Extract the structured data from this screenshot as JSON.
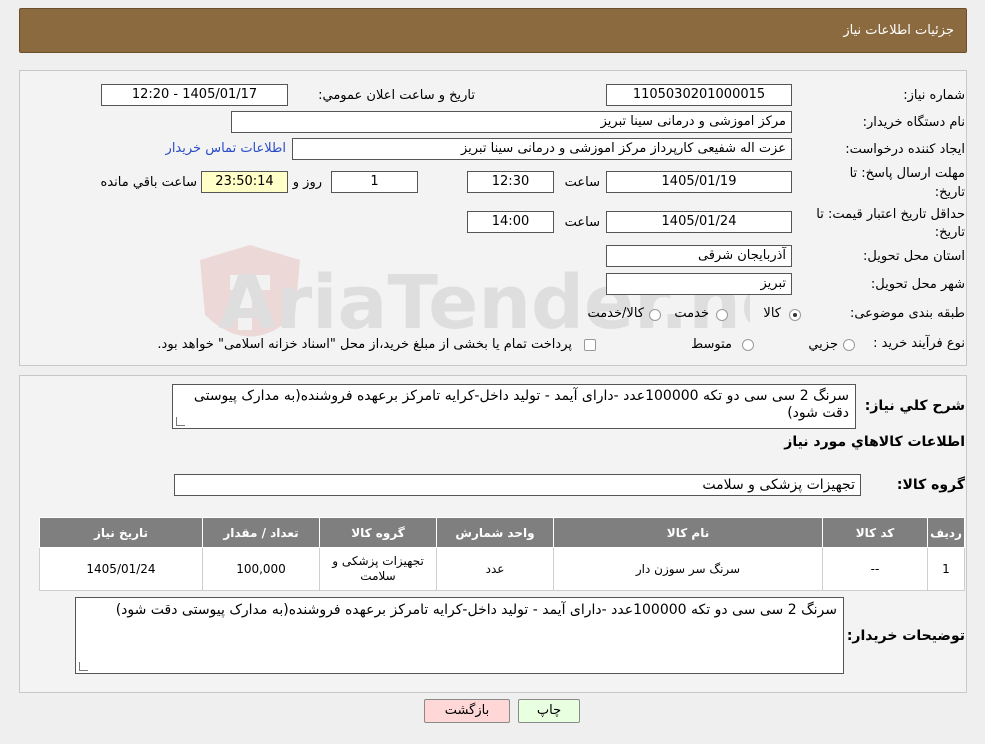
{
  "header": {
    "title": "جزئیات اطلاعات نیاز"
  },
  "watermark": {
    "text": "AriaTender.neT"
  },
  "form": {
    "need_number_label": "شماره نیاز:",
    "need_number": "1105030201000015",
    "announce_label": "تاریخ و ساعت اعلان عمومي:",
    "announce_value": "1405/01/17 - 12:20",
    "buyer_org_label": "نام دستگاه خريدار:",
    "buyer_org": "مرکز اموزشی و درمانی سینا تبریز",
    "creator_label": "ايجاد کننده درخواست:",
    "creator": "عزت اله شفیعی  کارپرداز مرکز اموزشی و درمانی سینا تبریز",
    "contact_link": "اطلاعات تماس خريدار",
    "deadline_label_1": "مهلت ارسال پاسخ: تا",
    "deadline_label_2": "تاريخ:",
    "deadline_date": "1405/01/19",
    "time_label": "ساعت",
    "deadline_time": "12:30",
    "days_value": "1",
    "days_label": "روز و",
    "remaining_time": "23:50:14",
    "remaining_label": "ساعت باقي مانده",
    "validity_label_1": "حداقل تاريخ اعتبار قيمت: تا",
    "validity_label_2": "تاريخ:",
    "validity_date": "1405/01/24",
    "validity_time": "14:00",
    "province_label": "استان محل تحويل:",
    "province": "آذربایجان شرقی",
    "city_label": "شهر محل تحويل:",
    "city": "تبریز",
    "category_label": "طبقه بندی موضوعی:",
    "category_options": [
      "کالا",
      "خدمت",
      "کالا/خدمت"
    ],
    "purchase_type_label": "نوع فرآيند خريد :",
    "purchase_options": [
      "جزيي",
      "متوسط"
    ],
    "purchase_note": "پرداخت تمام يا بخشی از مبلغ خريد،از محل \"اسناد خزانه اسلامی\" خواهد بود."
  },
  "summary": {
    "label": "شرح کلي نياز:",
    "text": "سرنگ 2 سی سی دو تکه  100000عدد -دارای آیمد - تولید داخل-کرایه تامرکز برعهده فروشنده(به مدارک پیوستی دقت شود)",
    "items_title": "اطلاعات کالاهاي مورد نياز",
    "group_label": "گروه کالا:",
    "group_value": "تجهیزات پزشکی و سلامت"
  },
  "table": {
    "headers": [
      "رديف",
      "کد کالا",
      "نام کالا",
      "واحد شمارش",
      "گروه کالا",
      "تعداد / مقدار",
      "تاريخ نياز"
    ],
    "rows": [
      [
        "1",
        "--",
        "سرنگ سر سوزن دار",
        "عدد",
        "تجهیزات پزشکی و سلامت",
        "100,000",
        "1405/01/24"
      ]
    ]
  },
  "buyer_notes": {
    "label": "توضيحات خريدار:",
    "text": "سرنگ 2 سی سی دو تکه  100000عدد -دارای آیمد - تولید داخل-کرایه تامرکز برعهده فروشنده(به مدارک پیوستی دقت شود)"
  },
  "buttons": {
    "print": "چاپ",
    "back": "بازگشت"
  },
  "colors": {
    "header": "#8b6a3f",
    "link": "#2a4cc8",
    "table_header": "#7f7f7f",
    "back_button": "#ffd7d7",
    "print_button": "#e8ffe0"
  }
}
